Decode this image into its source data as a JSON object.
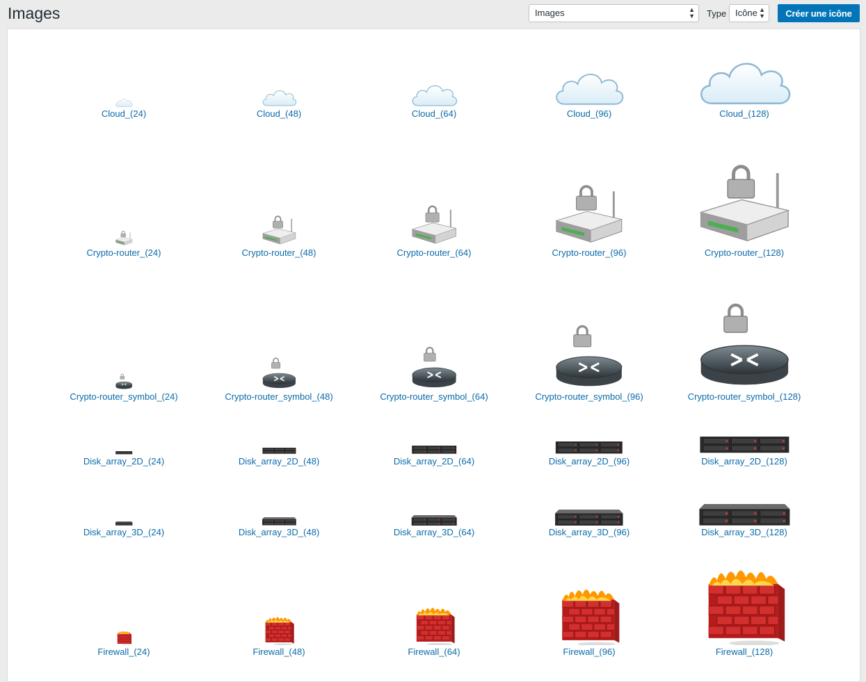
{
  "header": {
    "title": "Images",
    "view_select": "Images",
    "type_label": "Type",
    "type_select": "Icône",
    "create_button": "Créer une icône"
  },
  "rows": [
    {
      "kind": "cloud",
      "items": [
        {
          "label": "Cloud_(24)",
          "size": 24
        },
        {
          "label": "Cloud_(48)",
          "size": 48
        },
        {
          "label": "Cloud_(64)",
          "size": 64
        },
        {
          "label": "Cloud_(96)",
          "size": 96
        },
        {
          "label": "Cloud_(128)",
          "size": 128
        }
      ]
    },
    {
      "kind": "crypto-router",
      "items": [
        {
          "label": "Crypto-router_(24)",
          "size": 24
        },
        {
          "label": "Crypto-router_(48)",
          "size": 48
        },
        {
          "label": "Crypto-router_(64)",
          "size": 64
        },
        {
          "label": "Crypto-router_(96)",
          "size": 96
        },
        {
          "label": "Crypto-router_(128)",
          "size": 128
        }
      ]
    },
    {
      "kind": "crypto-router-symbol",
      "items": [
        {
          "label": "Crypto-router_symbol_(24)",
          "size": 24
        },
        {
          "label": "Crypto-router_symbol_(48)",
          "size": 48
        },
        {
          "label": "Crypto-router_symbol_(64)",
          "size": 64
        },
        {
          "label": "Crypto-router_symbol_(96)",
          "size": 96
        },
        {
          "label": "Crypto-router_symbol_(128)",
          "size": 128
        }
      ]
    },
    {
      "kind": "disk-array-2d",
      "items": [
        {
          "label": "Disk_array_2D_(24)",
          "size": 24
        },
        {
          "label": "Disk_array_2D_(48)",
          "size": 48
        },
        {
          "label": "Disk_array_2D_(64)",
          "size": 64
        },
        {
          "label": "Disk_array_2D_(96)",
          "size": 96
        },
        {
          "label": "Disk_array_2D_(128)",
          "size": 128
        }
      ]
    },
    {
      "kind": "disk-array-3d",
      "items": [
        {
          "label": "Disk_array_3D_(24)",
          "size": 24
        },
        {
          "label": "Disk_array_3D_(48)",
          "size": 48
        },
        {
          "label": "Disk_array_3D_(64)",
          "size": 64
        },
        {
          "label": "Disk_array_3D_(96)",
          "size": 96
        },
        {
          "label": "Disk_array_3D_(128)",
          "size": 128
        }
      ]
    },
    {
      "kind": "firewall",
      "items": [
        {
          "label": "Firewall_(24)",
          "size": 24
        },
        {
          "label": "Firewall_(48)",
          "size": 48
        },
        {
          "label": "Firewall_(64)",
          "size": 64
        },
        {
          "label": "Firewall_(96)",
          "size": 96
        },
        {
          "label": "Firewall_(128)",
          "size": 128
        }
      ]
    }
  ],
  "colors": {
    "link": "#0a6aa8",
    "button": "#0275b8",
    "background": "#ebebeb"
  }
}
